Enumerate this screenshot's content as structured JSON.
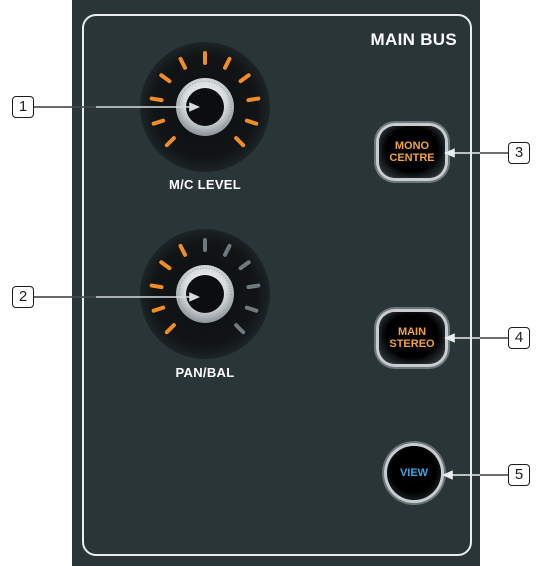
{
  "panel": {
    "title": "MAIN BUS"
  },
  "knobs": [
    {
      "label": "M/C LEVEL",
      "callout": "1"
    },
    {
      "label": "PAN/BAL",
      "callout": "2"
    }
  ],
  "buttons": [
    {
      "line1": "MONO",
      "line2": "CENTRE",
      "callout": "3"
    },
    {
      "line1": "MAIN",
      "line2": "STEREO",
      "callout": "4"
    },
    {
      "label": "VIEW",
      "callout": "5"
    }
  ],
  "colors": {
    "panel": "#2a3538",
    "led_active": "#f28c28",
    "led_inactive": "#6f7a7e",
    "button_text": "#f0a43a",
    "view_text": "#38a8e8"
  }
}
